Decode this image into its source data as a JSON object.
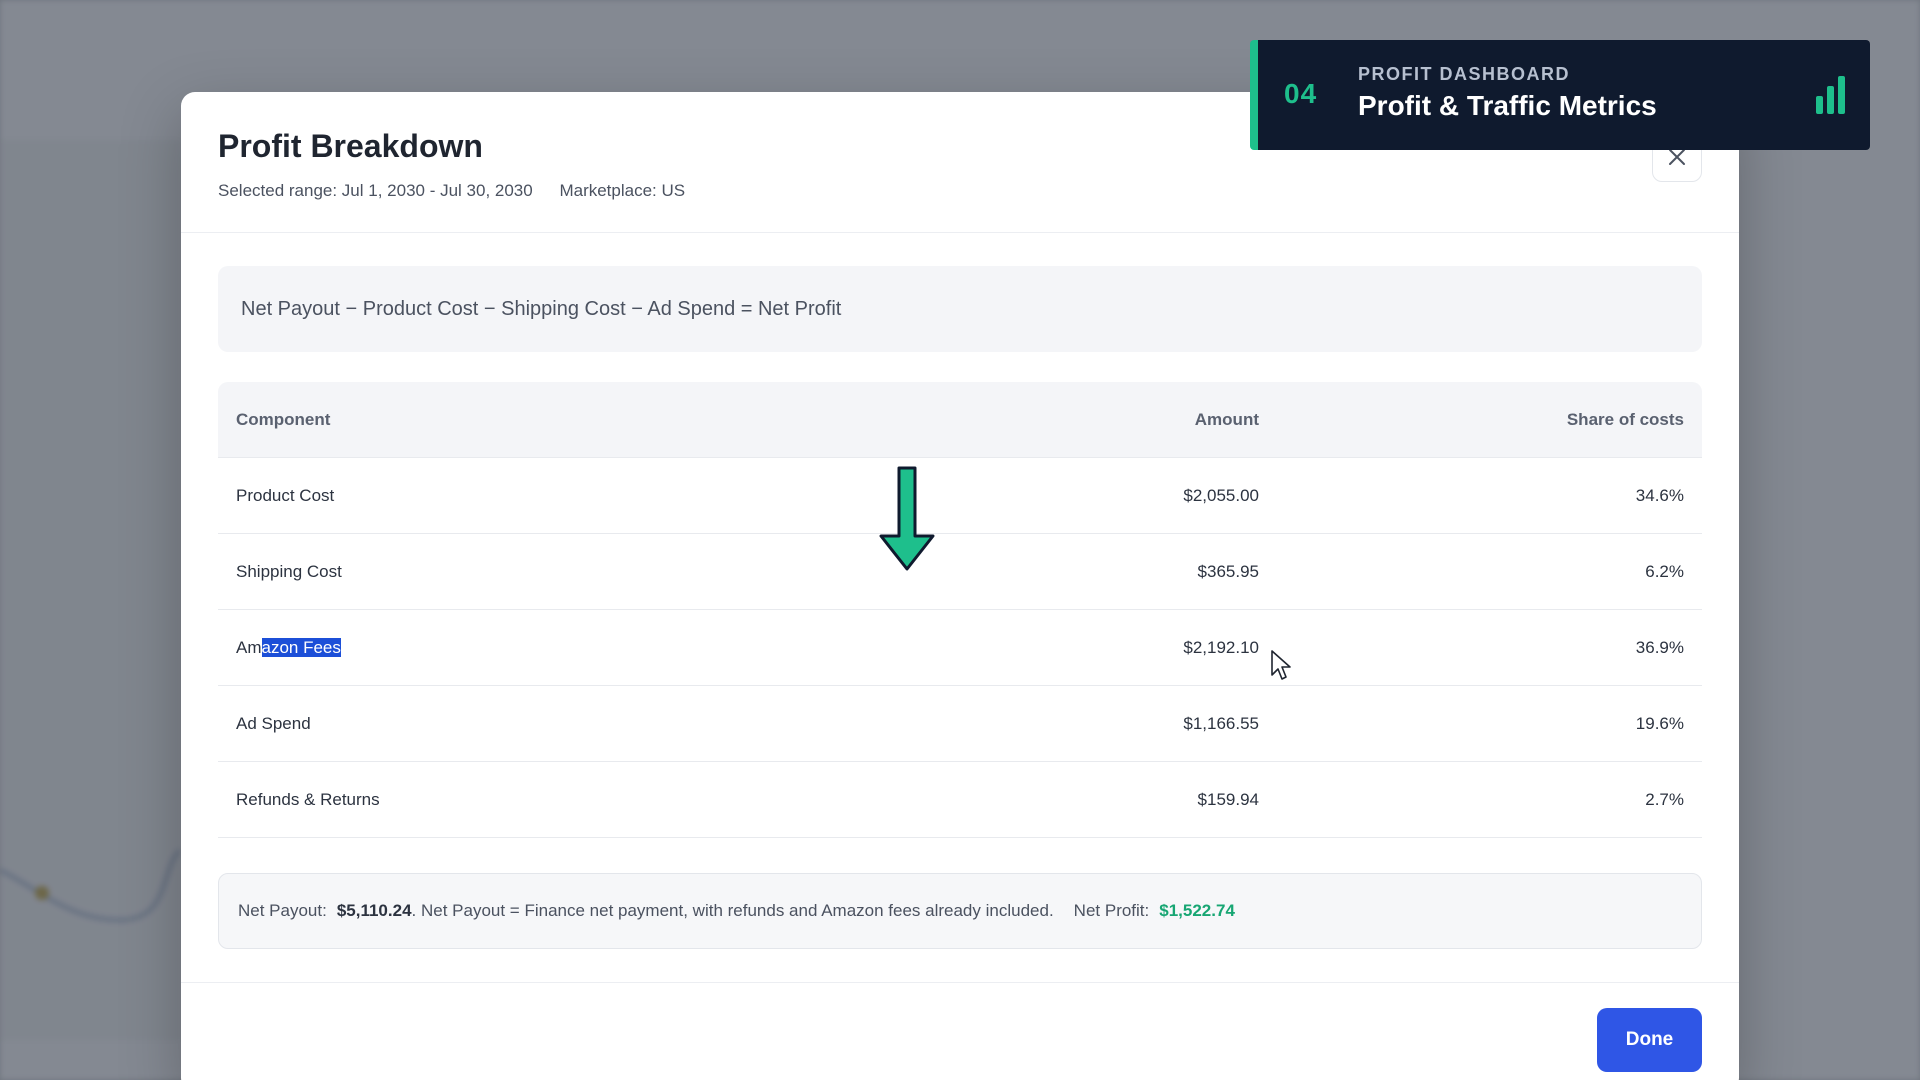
{
  "modal": {
    "title": "Profit Breakdown",
    "range_label": "Selected range: Jul 1, 2030 - Jul 30, 2030",
    "marketplace_label": "Marketplace: US",
    "close_icon": "close-icon",
    "formula": "Net Payout − Product Cost − Shipping Cost − Ad Spend = Net Profit",
    "table": {
      "headers": [
        "Component",
        "Amount",
        "Share of costs"
      ],
      "rows": [
        {
          "component": "Product Cost",
          "amount": "$2,055.00",
          "share": "34.6%"
        },
        {
          "component": "Shipping Cost",
          "amount": "$365.95",
          "share": "6.2%"
        },
        {
          "component_pre": "Am",
          "component_highlight": "azon Fees",
          "amount": "$2,192.10",
          "share": "36.9%"
        },
        {
          "component": "Ad Spend",
          "amount": "$1,166.55",
          "share": "19.6%"
        },
        {
          "component": "Refunds & Returns",
          "amount": "$159.94",
          "share": "2.7%"
        }
      ]
    },
    "summary": {
      "payout_label": "Net Payout:",
      "payout_value": "$5,110.24",
      "note": ". Net Payout = Finance net payment, with refunds and Amazon fees already included.",
      "profit_label": "Net Profit:",
      "profit_value": "$1,522.74"
    },
    "done_label": "Done"
  },
  "banner": {
    "number": "04",
    "kicker": "PROFIT DASHBOARD",
    "title": "Profit & Traffic Metrics",
    "icon": "bar-chart-icon"
  },
  "colors": {
    "accent_green": "#1ebf8c",
    "primary_blue": "#2f56e6",
    "profit_green": "#17a673",
    "banner_bg": "#0f1a2e"
  }
}
